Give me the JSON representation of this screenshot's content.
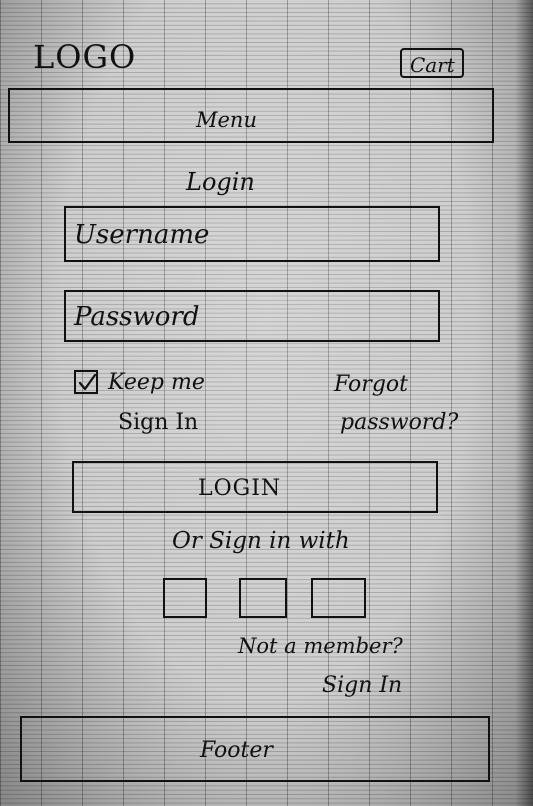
{
  "header": {
    "logo": "LOGO",
    "cart_label": "Cart"
  },
  "nav": {
    "menu_label": "Menu"
  },
  "login_form": {
    "title": "Login",
    "username_placeholder": "Username",
    "password_placeholder": "Password",
    "keep_signed_in_line1": "Keep me",
    "keep_signed_in_line2": "Sign In",
    "keep_signed_in_checked": true,
    "forgot_line1": "Forgot",
    "forgot_line2": "password?",
    "login_button": "LOGIN"
  },
  "social": {
    "prompt": "Or Sign in with",
    "icons": [
      "social-icon",
      "social-icon",
      "social-icon"
    ]
  },
  "signup": {
    "prompt": "Not a member?",
    "link": "Sign In"
  },
  "footer": {
    "label": "Footer"
  }
}
